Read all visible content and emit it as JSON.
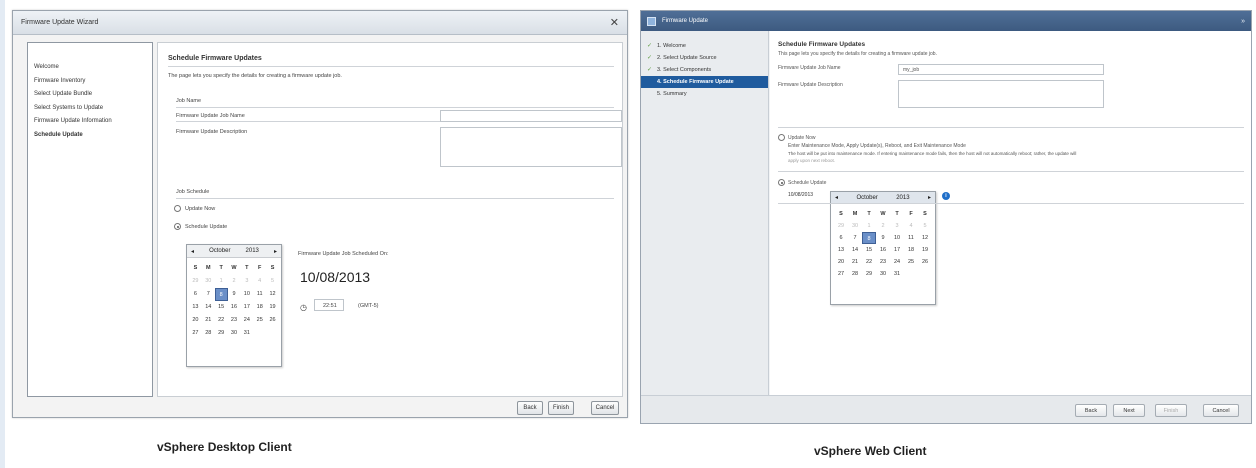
{
  "desktop": {
    "title": "Firmware Update Wizard",
    "nav": [
      "Welcome",
      "Firmware Inventory",
      "Select Update Bundle",
      "Select Systems to Update",
      "Firmware Update Information",
      "Schedule Update"
    ],
    "heading": "Schedule Firmware Updates",
    "description": "The page lets you specify the details for creating a firmware update job.",
    "job_name_section": "Job Name",
    "job_name_label": "Firmware Update Job Name",
    "job_desc_label": "Firmware Update Description",
    "job_schedule_section": "Job Schedule",
    "update_now": "Update Now",
    "schedule_update": "Schedule Update",
    "cal_month": "October",
    "cal_year": "2013",
    "scheduled_on_label": "Firmware Update Job Scheduled On:",
    "scheduled_date": "10/08/2013",
    "time_value": "22:51",
    "timezone": "(GMT-5)",
    "buttons": {
      "back": "Back",
      "finish": "Finish",
      "cancel": "Cancel"
    }
  },
  "web": {
    "title": "Firmware Update",
    "nav": [
      {
        "label": "1. Welcome",
        "done": true
      },
      {
        "label": "2. Select Update Source",
        "done": true
      },
      {
        "label": "3. Select Components",
        "done": true
      },
      {
        "label": "4. Schedule Firmware Update",
        "done": false,
        "active": true
      },
      {
        "label": "5. Summary",
        "done": false
      }
    ],
    "heading": "Schedule Firmware Updates",
    "description": "This page lets you specify the details for creating a firmware update job.",
    "job_name_label": "Firmware Update Job Name",
    "job_name_value": "my_job",
    "job_desc_label": "Firmware Update Description",
    "update_now": "Update Now",
    "update_now_desc": "Enter Maintenance Mode, Apply Update(s), Reboot, and Exit Maintenance Mode",
    "update_now_note": "The host will be put into maintenance mode. If entering maintenance mode fails, then the host will not automatically reboot; rather, the update will",
    "update_now_note2": "apply upon next reboot.",
    "schedule_update": "Schedule Update",
    "date_value": "10/08/2013",
    "cal_month": "October",
    "cal_year": "2013",
    "buttons": {
      "back": "Back",
      "next": "Next",
      "finish": "Finish",
      "cancel": "Cancel"
    }
  },
  "calendar": {
    "dows": [
      "S",
      "M",
      "T",
      "W",
      "T",
      "F",
      "S"
    ],
    "weeks": [
      [
        "29",
        "30",
        "1",
        "2",
        "3",
        "4",
        "5"
      ],
      [
        "6",
        "7",
        "8",
        "9",
        "10",
        "11",
        "12"
      ],
      [
        "13",
        "14",
        "15",
        "16",
        "17",
        "18",
        "19"
      ],
      [
        "20",
        "21",
        "22",
        "23",
        "24",
        "25",
        "26"
      ],
      [
        "27",
        "28",
        "29",
        "30",
        "31",
        "",
        ""
      ]
    ],
    "muted_first_row": 7,
    "selected": "8"
  },
  "captions": {
    "desktop": "vSphere Desktop Client",
    "web": "vSphere Web Client"
  }
}
